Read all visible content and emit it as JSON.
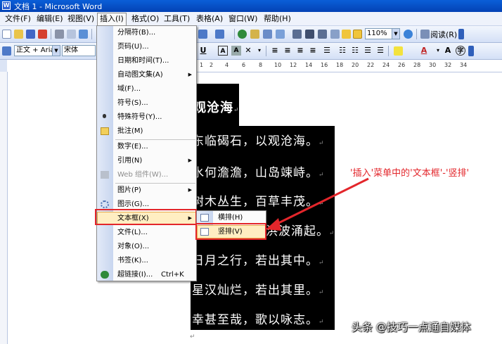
{
  "window": {
    "title": "文档 1 - Microsoft Word",
    "app_icon": "word-icon"
  },
  "menubar": {
    "items": [
      "文件(F)",
      "编辑(E)",
      "视图(V)",
      "插入(I)",
      "格式(O)",
      "工具(T)",
      "表格(A)",
      "窗口(W)",
      "帮助(H)"
    ],
    "active": "插入(I)"
  },
  "toolbar": {
    "zoom": "110%",
    "read_label": "阅读(R)",
    "style_value": "正文 + Aria",
    "font_value": "宋体"
  },
  "insert_menu": {
    "items": [
      {
        "label": "分隔符(B)...",
        "icon": ""
      },
      {
        "label": "页码(U)...",
        "icon": ""
      },
      {
        "label": "日期和时间(T)...",
        "icon": ""
      },
      {
        "label": "自动图文集(A)",
        "icon": "",
        "submenu": true
      },
      {
        "label": "域(F)...",
        "icon": ""
      },
      {
        "label": "符号(S)...",
        "icon": ""
      },
      {
        "label": "特殊符号(Y)...",
        "icon": "pin-icon"
      },
      {
        "label": "批注(M)",
        "icon": "folder-icon"
      },
      {
        "label": "数字(E)...",
        "icon": ""
      },
      {
        "label": "引用(N)",
        "icon": "",
        "submenu": true
      },
      {
        "label": "Web 组件(W)...",
        "icon": "web-component-icon",
        "disabled": true
      },
      {
        "label": "图片(P)",
        "icon": "",
        "submenu": true
      },
      {
        "label": "图示(G)...",
        "icon": "diagram-icon"
      },
      {
        "label": "文本框(X)",
        "icon": "",
        "submenu": true,
        "highlighted": true
      },
      {
        "label": "文件(L)...",
        "icon": ""
      },
      {
        "label": "对象(O)...",
        "icon": ""
      },
      {
        "label": "书签(K)...",
        "icon": ""
      },
      {
        "label": "超链接(I)...",
        "icon": "hyperlink-icon",
        "shortcut": "Ctrl+K"
      }
    ]
  },
  "textbox_submenu": {
    "items": [
      {
        "label": "横排(H)",
        "icon": "horizontal-textbox-icon"
      },
      {
        "label": "竖排(V)",
        "icon": "vertical-textbox-icon",
        "highlighted": true
      }
    ]
  },
  "ruler": {
    "numbers": [
      "1",
      "2",
      "4",
      "6",
      "8",
      "10",
      "12",
      "14",
      "16",
      "18",
      "20",
      "22",
      "24",
      "26",
      "28",
      "30",
      "32",
      "34"
    ]
  },
  "document": {
    "poem_title": "观沧海",
    "poem_lines": [
      "东临碣石，以观沧海。",
      "水何澹澹，山岛竦峙。",
      "树木丛生，百草丰茂。",
      "洪波涌起。",
      "日月之行，若出其中。",
      "星汉灿烂，若出其里。",
      "幸甚至哉，歌以咏志。"
    ],
    "paragraph_mark": "↵"
  },
  "annotation": "'插入'菜单中的'文本框'-'竖排'",
  "watermark": "头条 @技巧一点通自媒体",
  "colors": {
    "highlight": "#ffeec2",
    "annotation_red": "#e3262b",
    "titlebar_blue": "#0a5fd8"
  }
}
